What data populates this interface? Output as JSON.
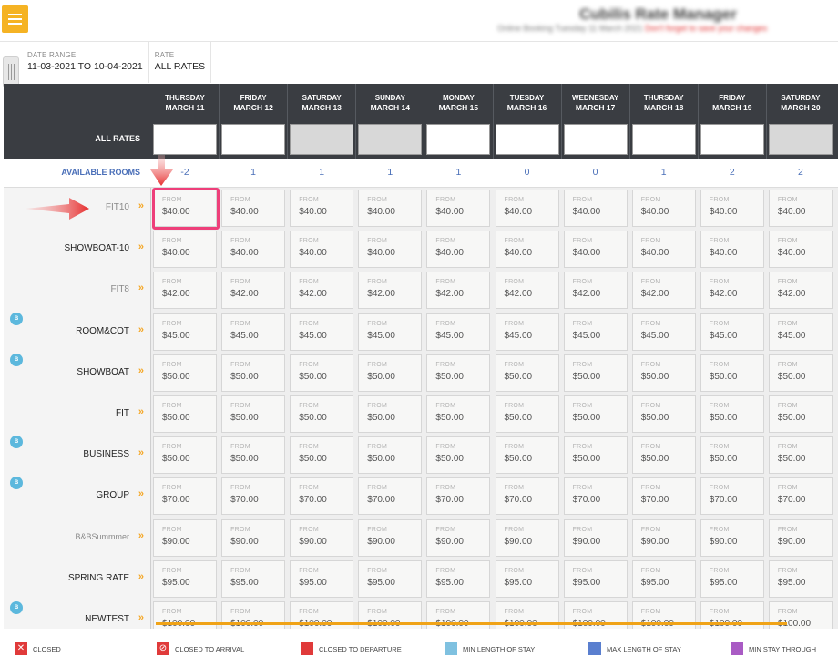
{
  "header": {
    "title": "Cubilis  Rate Manager",
    "subtitle": "Online Booking    Tuesday 11 March 2021",
    "warning": "Don't forget to save your changes"
  },
  "filters": [
    {
      "label": "DATE RANGE",
      "value": "11-03-2021 TO 10-04-2021"
    },
    {
      "label": "RATE",
      "value": "ALL RATES"
    }
  ],
  "grid": {
    "all_rates_label": "ALL RATES",
    "available_rooms_label": "AVAILABLE ROOMS",
    "dates": [
      {
        "day": "THURSDAY",
        "date": "MARCH 11",
        "available": "-2",
        "closed": false
      },
      {
        "day": "FRIDAY",
        "date": "MARCH 12",
        "available": "1",
        "closed": false
      },
      {
        "day": "SATURDAY",
        "date": "MARCH 13",
        "available": "1",
        "closed": true
      },
      {
        "day": "SUNDAY",
        "date": "MARCH 14",
        "available": "1",
        "closed": true
      },
      {
        "day": "MONDAY",
        "date": "MARCH 15",
        "available": "1",
        "closed": false
      },
      {
        "day": "TUESDAY",
        "date": "MARCH 16",
        "available": "0",
        "closed": false
      },
      {
        "day": "WEDNESDAY",
        "date": "MARCH 17",
        "available": "0",
        "closed": false
      },
      {
        "day": "THURSDAY",
        "date": "MARCH 18",
        "available": "1",
        "closed": false
      },
      {
        "day": "FRIDAY",
        "date": "MARCH 19",
        "available": "2",
        "closed": false
      },
      {
        "day": "SATURDAY",
        "date": "MARCH 20",
        "available": "2",
        "closed": true
      }
    ],
    "from_label": "FROM",
    "rates": [
      {
        "name": "FIT10",
        "price": "$40.00",
        "muted": true,
        "badge": false
      },
      {
        "name": "SHOWBOAT-10",
        "price": "$40.00",
        "muted": false,
        "badge": false
      },
      {
        "name": "FIT8",
        "price": "$42.00",
        "muted": true,
        "badge": false
      },
      {
        "name": "ROOM&COT",
        "price": "$45.00",
        "muted": false,
        "badge": true
      },
      {
        "name": "SHOWBOAT",
        "price": "$50.00",
        "muted": false,
        "badge": true
      },
      {
        "name": "FIT",
        "price": "$50.00",
        "muted": false,
        "badge": false
      },
      {
        "name": "BUSINESS",
        "price": "$50.00",
        "muted": false,
        "badge": true
      },
      {
        "name": "GROUP",
        "price": "$70.00",
        "muted": false,
        "badge": true
      },
      {
        "name": "B&BSummmer",
        "price": "$90.00",
        "muted": true,
        "badge": false
      },
      {
        "name": "SPRING RATE",
        "price": "$95.00",
        "muted": false,
        "badge": false
      },
      {
        "name": "NEWTEST",
        "price": "$100.00",
        "muted": false,
        "badge": true
      }
    ],
    "badge_text": "B",
    "chevron": "»"
  },
  "legend": [
    {
      "label": "CLOSED",
      "color": "#e03a3a",
      "symbol": "✕"
    },
    {
      "label": "CLOSED TO ARRIVAL",
      "color": "#e03a3a",
      "symbol": "⊘"
    },
    {
      "label": "CLOSED TO DEPARTURE",
      "color": "#e03a3a",
      "symbol": ""
    },
    {
      "label": "MIN LENGTH OF STAY",
      "color": "#7fc1e0",
      "symbol": ""
    },
    {
      "label": "MAX LENGTH OF STAY",
      "color": "#5a7fcf",
      "symbol": ""
    },
    {
      "label": "MIN STAY THROUGH",
      "color": "#a95bc4",
      "symbol": ""
    }
  ]
}
